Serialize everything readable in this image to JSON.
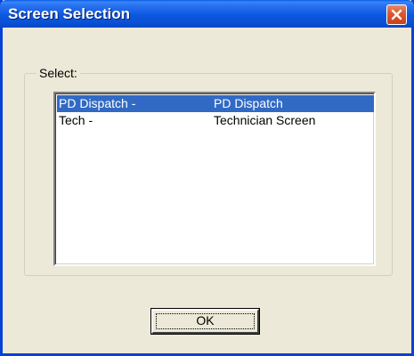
{
  "window": {
    "title": "Screen Selection",
    "close_icon": "close-icon"
  },
  "group": {
    "label": "Select:"
  },
  "list": {
    "items": [
      {
        "code": "PD Dispatch -",
        "name": "PD Dispatch",
        "selected": true
      },
      {
        "code": "Tech -",
        "name": "Technician Screen",
        "selected": false
      }
    ]
  },
  "buttons": {
    "ok_label": "OK"
  },
  "colors": {
    "titlebar": "#0a52d6",
    "dialog_bg": "#ece9d8",
    "selection": "#316ac5",
    "close_button": "#dc5b32"
  }
}
